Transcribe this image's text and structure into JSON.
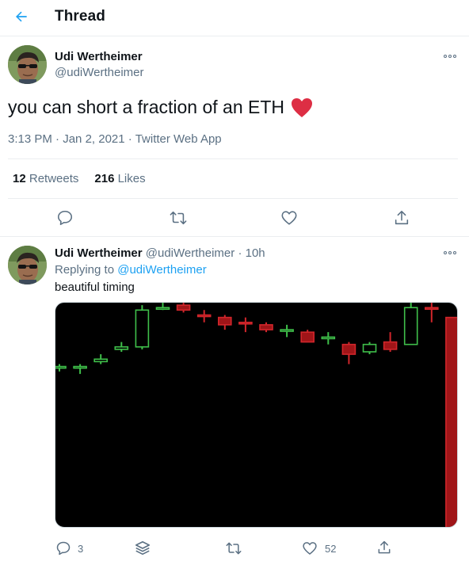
{
  "header": {
    "title": "Thread"
  },
  "main_tweet": {
    "author_name": "Udi Wertheimer",
    "author_handle": "@udiWertheimer",
    "text": "you can short a fraction of an ETH",
    "emoji": "red-heart",
    "time": "3:13 PM",
    "date": "Jan 2, 2021",
    "source": "Twitter Web App",
    "retweets_count": "12",
    "retweets_label": "Retweets",
    "likes_count": "216",
    "likes_label": "Likes"
  },
  "reply_tweet": {
    "author_name": "Udi Wertheimer",
    "author_handle": "@udiWertheimer",
    "separator": "·",
    "time_ago": "10h",
    "replying_prefix": "Replying to",
    "replying_to": "@udiWertheimer",
    "text": "beautiful timing",
    "reply_count": "3",
    "like_count": "52"
  },
  "colors": {
    "accent": "#1da1f2",
    "muted": "#5b7083",
    "candle_up": "#3fbf4a",
    "candle_down": "#d1262b",
    "chart_bg": "#000000"
  },
  "chart_data": {
    "type": "candlestick",
    "title": "",
    "candles": [
      {
        "open": 66,
        "close": 66,
        "high": 67,
        "low": 64,
        "dir": "up"
      },
      {
        "open": 66,
        "close": 66,
        "high": 67,
        "low": 63,
        "dir": "up"
      },
      {
        "open": 68,
        "close": 69,
        "high": 71,
        "low": 67,
        "dir": "up"
      },
      {
        "open": 73,
        "close": 74,
        "high": 76,
        "low": 72,
        "dir": "up"
      },
      {
        "open": 74,
        "close": 89,
        "high": 91,
        "low": 73,
        "dir": "up"
      },
      {
        "open": 90,
        "close": 90,
        "high": 92,
        "low": 89,
        "dir": "up"
      },
      {
        "open": 91,
        "close": 89,
        "high": 92,
        "low": 88,
        "dir": "down"
      },
      {
        "open": 87,
        "close": 87,
        "high": 89,
        "low": 84,
        "dir": "down"
      },
      {
        "open": 86,
        "close": 83,
        "high": 87,
        "low": 81,
        "dir": "down"
      },
      {
        "open": 84,
        "close": 84,
        "high": 86,
        "low": 80,
        "dir": "down"
      },
      {
        "open": 83,
        "close": 81,
        "high": 84,
        "low": 80,
        "dir": "down"
      },
      {
        "open": 81,
        "close": 81,
        "high": 83,
        "low": 78,
        "dir": "up"
      },
      {
        "open": 80,
        "close": 76,
        "high": 81,
        "low": 76,
        "dir": "down"
      },
      {
        "open": 78,
        "close": 78,
        "high": 80,
        "low": 75,
        "dir": "up"
      },
      {
        "open": 75,
        "close": 71,
        "high": 76,
        "low": 67,
        "dir": "down"
      },
      {
        "open": 72,
        "close": 75,
        "high": 76,
        "low": 71,
        "dir": "up"
      },
      {
        "open": 76,
        "close": 73,
        "high": 80,
        "low": 72,
        "dir": "down"
      },
      {
        "open": 75,
        "close": 90,
        "high": 92,
        "low": 75,
        "dir": "up"
      },
      {
        "open": 90,
        "close": 90,
        "high": 92,
        "low": 84,
        "dir": "down"
      },
      {
        "open": 86,
        "close": 0,
        "high": 86,
        "low": 0,
        "dir": "down"
      }
    ],
    "ylim": [
      0,
      92
    ]
  }
}
